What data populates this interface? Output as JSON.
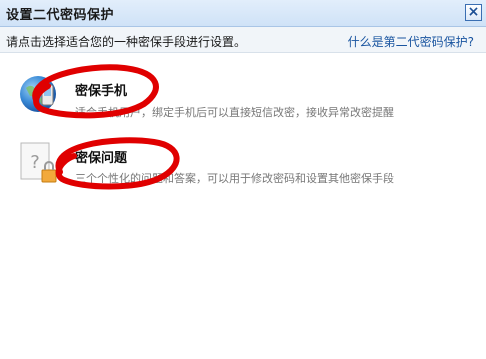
{
  "dialog": {
    "title": "设置二代密码保护",
    "close_label": "×"
  },
  "info": {
    "hint": "请点击选择适合您的一种密保手段进行设置。",
    "help_link": "什么是第二代密码保护?"
  },
  "options": [
    {
      "title": "密保手机",
      "desc": "适合手机用户，绑定手机后可以直接短信改密，接收异常改密提醒",
      "icon": "phone-globe-icon"
    },
    {
      "title": "密保问题",
      "desc": "三个个性化的问题和答案，可以用于修改密码和设置其他密保手段",
      "icon": "question-document-lock-icon",
      "icon_glyph": "?"
    }
  ],
  "colors": {
    "accent": "#1a55a0",
    "annotation": "#e00000",
    "titlebar": "#cfe2f7"
  }
}
